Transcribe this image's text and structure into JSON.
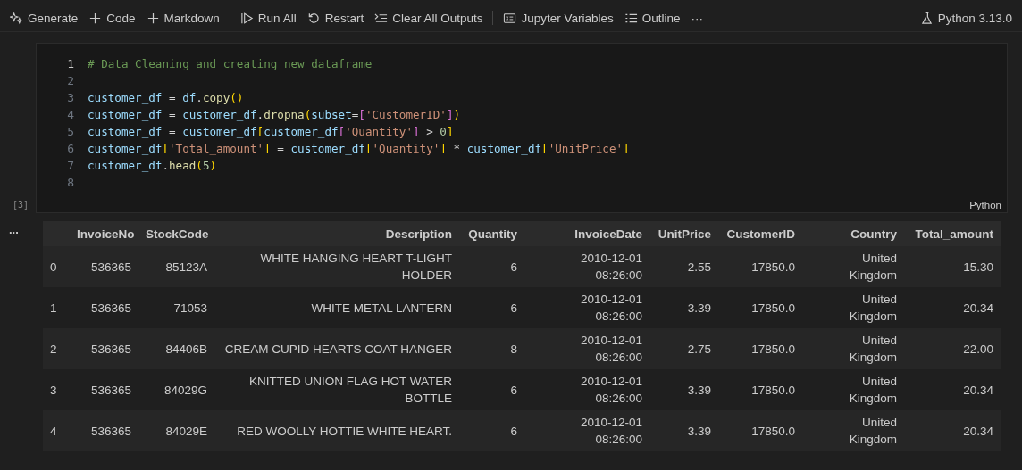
{
  "toolbar": {
    "items": [
      {
        "label": "Generate"
      },
      {
        "label": "Code"
      },
      {
        "label": "Markdown",
        "divider_after": true
      },
      {
        "label": "Run All"
      },
      {
        "label": "Restart"
      },
      {
        "label": "Clear All Outputs",
        "divider_after": true
      },
      {
        "label": "Jupyter Variables"
      },
      {
        "label": "Outline"
      },
      {
        "label": "···"
      }
    ],
    "kernel": "Python 3.13.0"
  },
  "cell": {
    "execution_count": "[3]",
    "language": "Python",
    "lines": [
      {
        "number": "1",
        "tokens": [
          {
            "text": "# Data Cleaning and creating new dataframe",
            "kind": "comment"
          }
        ]
      },
      {
        "number": "2"
      },
      {
        "number": "3",
        "tokens": [
          {
            "text": "customer_df",
            "kind": "var"
          },
          {
            "text": " = ",
            "kind": "op"
          },
          {
            "text": "df",
            "kind": "var"
          },
          {
            "text": ".",
            "kind": "op"
          },
          {
            "text": "copy",
            "kind": "func"
          },
          {
            "text": "()",
            "kind": "paren"
          }
        ]
      },
      {
        "number": "4",
        "tokens": [
          {
            "text": "customer_df",
            "kind": "var"
          },
          {
            "text": " = ",
            "kind": "op"
          },
          {
            "text": "customer_df",
            "kind": "var"
          },
          {
            "text": ".",
            "kind": "op"
          },
          {
            "text": "dropna",
            "kind": "func"
          },
          {
            "text": "(",
            "kind": "paren"
          },
          {
            "text": "subset",
            "kind": "var"
          },
          {
            "text": "=",
            "kind": "op"
          },
          {
            "text": "[",
            "kind": "bracket"
          },
          {
            "text": "'CustomerID'",
            "kind": "string"
          },
          {
            "text": "]",
            "kind": "bracket"
          },
          {
            "text": ")",
            "kind": "paren"
          }
        ]
      },
      {
        "number": "5",
        "tokens": [
          {
            "text": "customer_df",
            "kind": "var"
          },
          {
            "text": " = ",
            "kind": "op"
          },
          {
            "text": "customer_df",
            "kind": "var"
          },
          {
            "text": "[",
            "kind": "paren"
          },
          {
            "text": "customer_df",
            "kind": "var"
          },
          {
            "text": "[",
            "kind": "bracket"
          },
          {
            "text": "'Quantity'",
            "kind": "string"
          },
          {
            "text": "]",
            "kind": "bracket"
          },
          {
            "text": " > ",
            "kind": "op"
          },
          {
            "text": "0",
            "kind": "number"
          },
          {
            "text": "]",
            "kind": "paren"
          }
        ]
      },
      {
        "number": "6",
        "tokens": [
          {
            "text": "customer_df",
            "kind": "var"
          },
          {
            "text": "[",
            "kind": "paren"
          },
          {
            "text": "'Total_amount'",
            "kind": "string"
          },
          {
            "text": "]",
            "kind": "paren"
          },
          {
            "text": " = ",
            "kind": "op"
          },
          {
            "text": "customer_df",
            "kind": "var"
          },
          {
            "text": "[",
            "kind": "paren"
          },
          {
            "text": "'Quantity'",
            "kind": "string"
          },
          {
            "text": "]",
            "kind": "paren"
          },
          {
            "text": " * ",
            "kind": "op"
          },
          {
            "text": "customer_df",
            "kind": "var"
          },
          {
            "text": "[",
            "kind": "paren"
          },
          {
            "text": "'UnitPrice'",
            "kind": "string"
          },
          {
            "text": "]",
            "kind": "paren"
          }
        ]
      },
      {
        "number": "7",
        "tokens": [
          {
            "text": "customer_df",
            "kind": "var"
          },
          {
            "text": ".",
            "kind": "op"
          },
          {
            "text": "head",
            "kind": "func"
          },
          {
            "text": "(",
            "kind": "paren"
          },
          {
            "text": "5",
            "kind": "number"
          },
          {
            "text": ")",
            "kind": "paren"
          }
        ]
      },
      {
        "number": "8"
      }
    ]
  },
  "output": {
    "menu": "...",
    "table": {
      "columns": [
        "",
        "InvoiceNo",
        "StockCode",
        "Description",
        "Quantity",
        "InvoiceDate",
        "UnitPrice",
        "CustomerID",
        "Country",
        "Total_amount"
      ],
      "rows": [
        [
          "0",
          "536365",
          "85123A",
          "WHITE HANGING HEART T-LIGHT HOLDER",
          "6",
          "2010-12-01 08:26:00",
          "2.55",
          "17850.0",
          "United Kingdom",
          "15.30"
        ],
        [
          "1",
          "536365",
          "71053",
          "WHITE METAL LANTERN",
          "6",
          "2010-12-01 08:26:00",
          "3.39",
          "17850.0",
          "United Kingdom",
          "20.34"
        ],
        [
          "2",
          "536365",
          "84406B",
          "CREAM CUPID HEARTS COAT HANGER",
          "8",
          "2010-12-01 08:26:00",
          "2.75",
          "17850.0",
          "United Kingdom",
          "22.00"
        ],
        [
          "3",
          "536365",
          "84029G",
          "KNITTED UNION FLAG HOT WATER BOTTLE",
          "6",
          "2010-12-01 08:26:00",
          "3.39",
          "17850.0",
          "United Kingdom",
          "20.34"
        ],
        [
          "4",
          "536365",
          "84029E",
          "RED WOOLLY HOTTIE WHITE HEART.",
          "6",
          "2010-12-01 08:26:00",
          "3.39",
          "17850.0",
          "United Kingdom",
          "20.34"
        ]
      ]
    }
  }
}
